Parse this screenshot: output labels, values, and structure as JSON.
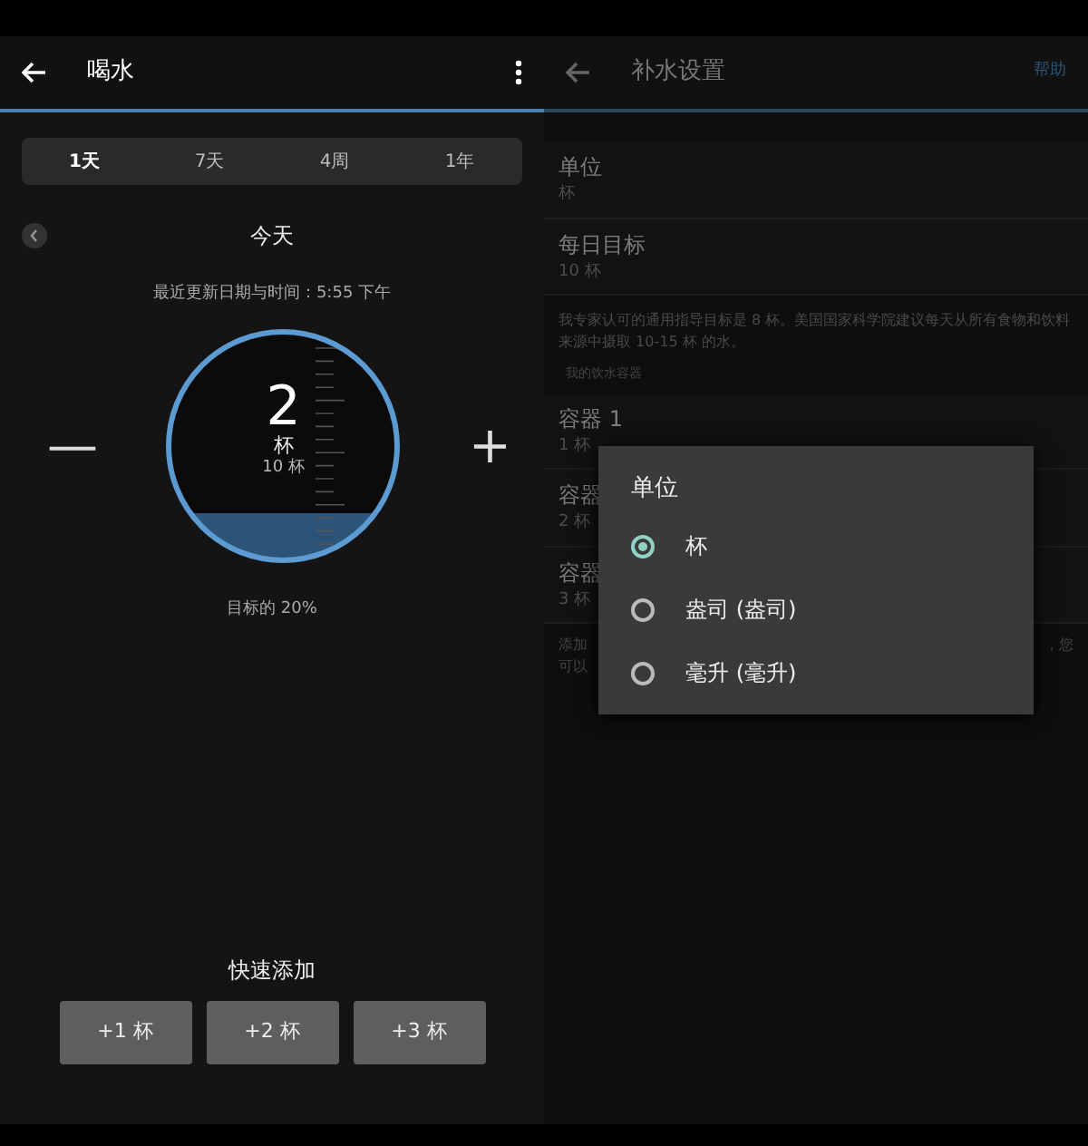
{
  "left": {
    "title": "喝水",
    "tabs": [
      {
        "label": "1天",
        "selected": true
      },
      {
        "label": "7天",
        "selected": false
      },
      {
        "label": "4周",
        "selected": false
      },
      {
        "label": "1年",
        "selected": false
      }
    ],
    "day_label": "今天",
    "last_update": "最近更新日期与时间：5:55 下午",
    "minus": "—",
    "plus": "+",
    "gauge": {
      "value": "2",
      "unit": "杯",
      "goal": "10 杯",
      "level": 0.2
    },
    "goal_percent": "目标的 20%",
    "quick_add": {
      "label": "快速添加",
      "buttons": [
        "+1 杯",
        "+2 杯",
        "+3 杯"
      ]
    }
  },
  "right": {
    "title": "补水设置",
    "help": "帮助",
    "settings": [
      {
        "label": "单位",
        "value": "杯"
      },
      {
        "label": "每日目标",
        "value": "10 杯"
      }
    ],
    "description": "我专家认可的通用指导目标是 8 杯。美国国家科学院建议每天从所有食物和饮料来源中摄取 10-15 杯 的水。",
    "section": "我的饮水容器",
    "containers": [
      {
        "label": "容器 1",
        "value": "1 杯"
      },
      {
        "label": "容器",
        "value": "2 杯"
      },
      {
        "label": "容器",
        "value": "3 杯"
      }
    ],
    "footer": [
      "添加",
      "，您",
      "可以"
    ],
    "dialog": {
      "title": "单位",
      "options": [
        {
          "label": "杯",
          "selected": true
        },
        {
          "label": "盎司 (盎司)",
          "selected": false
        },
        {
          "label": "毫升 (毫升)",
          "selected": false
        }
      ]
    }
  }
}
